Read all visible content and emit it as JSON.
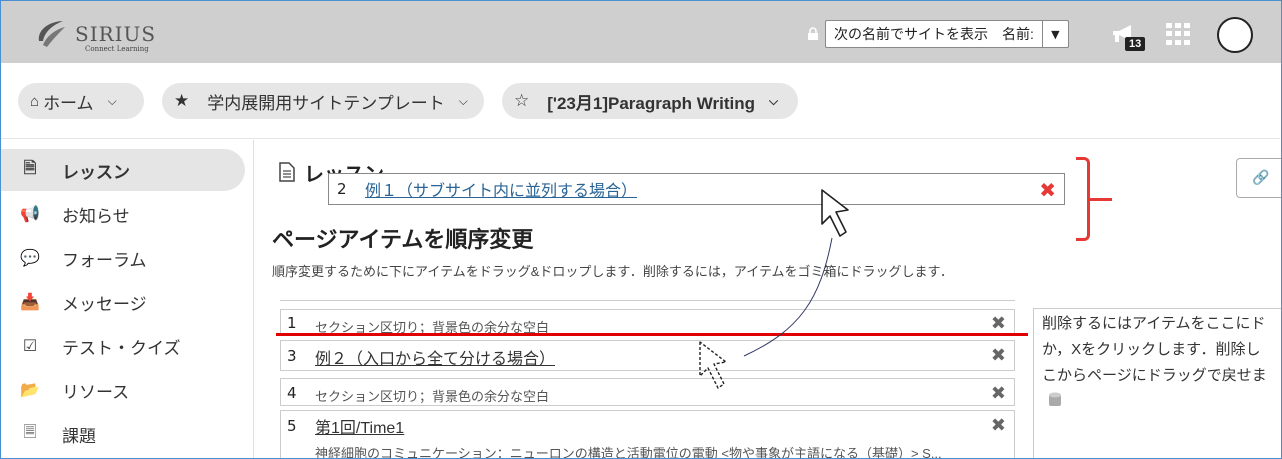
{
  "header": {
    "logo_text": "SIRIUS",
    "logo_subtitle": "Connect Learning",
    "view_as_label": "次の名前でサイトを表示　名前:",
    "notification_count": "13"
  },
  "breadcrumbs": [
    {
      "label": "ホーム"
    },
    {
      "label": "学内展開用サイトテンプレート"
    },
    {
      "label": "['23月1]Paragraph Writing"
    }
  ],
  "sidebar": {
    "items": [
      {
        "label": "レッスン",
        "icon": "document-icon",
        "active": true
      },
      {
        "label": "お知らせ",
        "icon": "megaphone-icon"
      },
      {
        "label": "フォーラム",
        "icon": "chat-bubbles-icon"
      },
      {
        "label": "メッセージ",
        "icon": "inbox-icon"
      },
      {
        "label": "テスト・クイズ",
        "icon": "checkbox-icon"
      },
      {
        "label": "リソース",
        "icon": "folder-icon"
      },
      {
        "label": "課題",
        "icon": "assignment-icon"
      }
    ]
  },
  "main": {
    "lesson_title": "レッスン",
    "dragging_item": {
      "number": "2",
      "label": "例１（サブサイト内に並列する場合）"
    },
    "heading": "ページアイテムを順序変更",
    "instructions": "順序変更するために下にアイテムをドラッグ&ドロップします．削除するには，アイテムをゴミ箱にドラッグします．",
    "items": [
      {
        "number": "1",
        "label": "セクション区切り；背景色の余分な空白",
        "type": "section"
      },
      {
        "number": "3",
        "label": "例２（入口から全て分ける場合）",
        "type": "link"
      },
      {
        "number": "4",
        "label": "セクション区切り；背景色の余分な空白",
        "type": "section"
      },
      {
        "number": "5",
        "label": "第1回/Time1",
        "type": "link",
        "description": "神経細胞のコミュニケーション：ニューロンの構造と活動電位の電動 <物や事象が主語になる（基礎）> S..."
      }
    ],
    "trash_text": [
      "削除するにはアイテムをここにド",
      "か，Xをクリックします．削除し",
      "こからページにドラッグで戻せま"
    ]
  },
  "colors": {
    "accent_red": "#e53935",
    "link_blue": "#2a6496",
    "header_gray": "#cfcfcf"
  }
}
